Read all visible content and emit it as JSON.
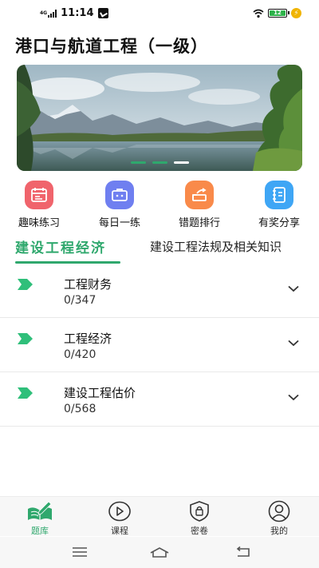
{
  "status_bar": {
    "network": "4G",
    "time": "11:14",
    "battery": "12"
  },
  "page": {
    "title": "港口与航道工程（一级）"
  },
  "banner": {
    "slides": 3,
    "active_slide": 3
  },
  "quick_actions": [
    {
      "label": "趣味练习",
      "icon": "calendar-icon",
      "color": "#f0646c"
    },
    {
      "label": "每日一练",
      "icon": "briefcase-icon",
      "color": "#6f7ff0"
    },
    {
      "label": "错题排行",
      "icon": "trend-icon",
      "color": "#f98a4a"
    },
    {
      "label": "有奖分享",
      "icon": "notebook-icon",
      "color": "#3fa6f5"
    }
  ],
  "tabs": [
    {
      "label": "建设工程经济",
      "active": true
    },
    {
      "label": "建设工程法规及相关知识",
      "active": false
    }
  ],
  "chapters": [
    {
      "name": "工程财务",
      "progress": "0/347"
    },
    {
      "name": "工程经济",
      "progress": "0/420"
    },
    {
      "name": "建设工程估价",
      "progress": "0/568"
    }
  ],
  "bottom_nav": [
    {
      "label": "题库",
      "icon": "book-icon",
      "active": true
    },
    {
      "label": "课程",
      "icon": "play-icon",
      "active": false
    },
    {
      "label": "密卷",
      "icon": "lock-shield-icon",
      "active": false
    },
    {
      "label": "我的",
      "icon": "user-icon",
      "active": false
    }
  ],
  "colors": {
    "accent": "#2fa86d",
    "text": "#111111"
  }
}
